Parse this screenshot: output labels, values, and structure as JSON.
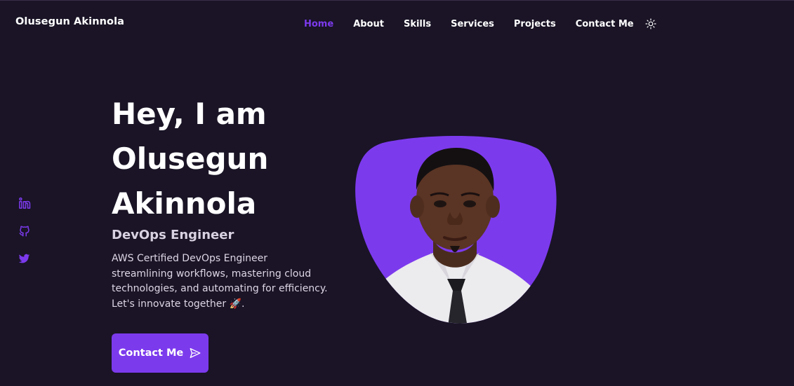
{
  "header": {
    "logo": "Olusegun Akinnola",
    "nav": [
      {
        "label": "Home",
        "active": true
      },
      {
        "label": "About",
        "active": false
      },
      {
        "label": "Skills",
        "active": false
      },
      {
        "label": "Services",
        "active": false
      },
      {
        "label": "Projects",
        "active": false
      },
      {
        "label": "Contact Me",
        "active": false
      }
    ],
    "theme_icon": "sun-icon"
  },
  "social": [
    {
      "icon": "linkedin-icon"
    },
    {
      "icon": "github-icon"
    },
    {
      "icon": "twitter-icon"
    }
  ],
  "hero": {
    "title_lines": [
      "Hey, I am",
      "Olusegun",
      "Akinnola"
    ],
    "subtitle": "DevOps Engineer",
    "description": "AWS Certified DevOps Engineer streamlining workflows, mastering cloud technologies, and automating for efficiency. Let's innovate together 🚀.",
    "cta_label": "Contact Me",
    "cta_icon": "send-icon"
  },
  "colors": {
    "background": "#1a1426",
    "accent": "#7c3aed",
    "text": "#ffffff",
    "muted_text": "#dcd6e6"
  }
}
